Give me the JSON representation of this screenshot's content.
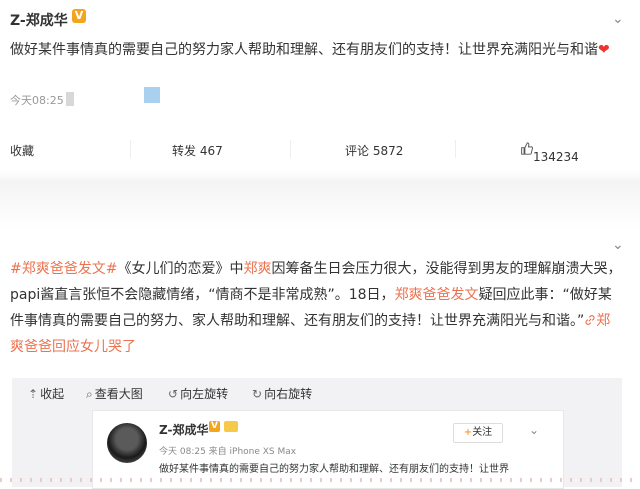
{
  "post1": {
    "username": "Z-郑成华",
    "verified_badge": "V",
    "text": "做好某件事情真的需要自己的努力家人帮助和理解、还有朋友们的支持！让世界充满阳光与和谐",
    "heart": "❤",
    "time": "今天08:25",
    "actions": {
      "favorite": "收藏",
      "repost": "转发 467",
      "comment": "评论 5872",
      "like_icon": "thumbs-up-icon",
      "like": "134234"
    }
  },
  "post2": {
    "text_parts": [
      "#郑爽爸爸发文#",
      "《女儿们的恋爱》中",
      "郑爽",
      "因筹备生日会压力很大，没能得到男友的理解崩溃大哭，papi酱直言张恒不会隐藏情绪，“情商不是非常成熟”。18日，",
      "郑爽爸爸发文",
      "疑回应此事：“做好某件事情真的需要自己的努力、家人帮助和理解、还有朋友们的支持！让世界充满阳光与和谐。”",
      "郑爽爸爸",
      "回应女儿哭了"
    ],
    "link_icon": "link-icon",
    "media_toolbar": {
      "collapse": "收起",
      "view_large": "查看大图",
      "rotate_left": "向左旋转",
      "rotate_right": "向右旋转"
    },
    "embedded": {
      "username": "Z-郑成华",
      "verified_badge": "V",
      "follow": "关注",
      "follow_plus": "+",
      "meta": "今天 08:25 来自 iPhone XS Max",
      "text": "做好某件事情真的需要自己的努力家人帮助和理解、还有朋友们的支持！让世界"
    }
  },
  "colors": {
    "highlight": "#eb7350",
    "verified": "#f2a51d",
    "follow_plus": "#ff8200",
    "media_bg": "#f2f2f5"
  }
}
